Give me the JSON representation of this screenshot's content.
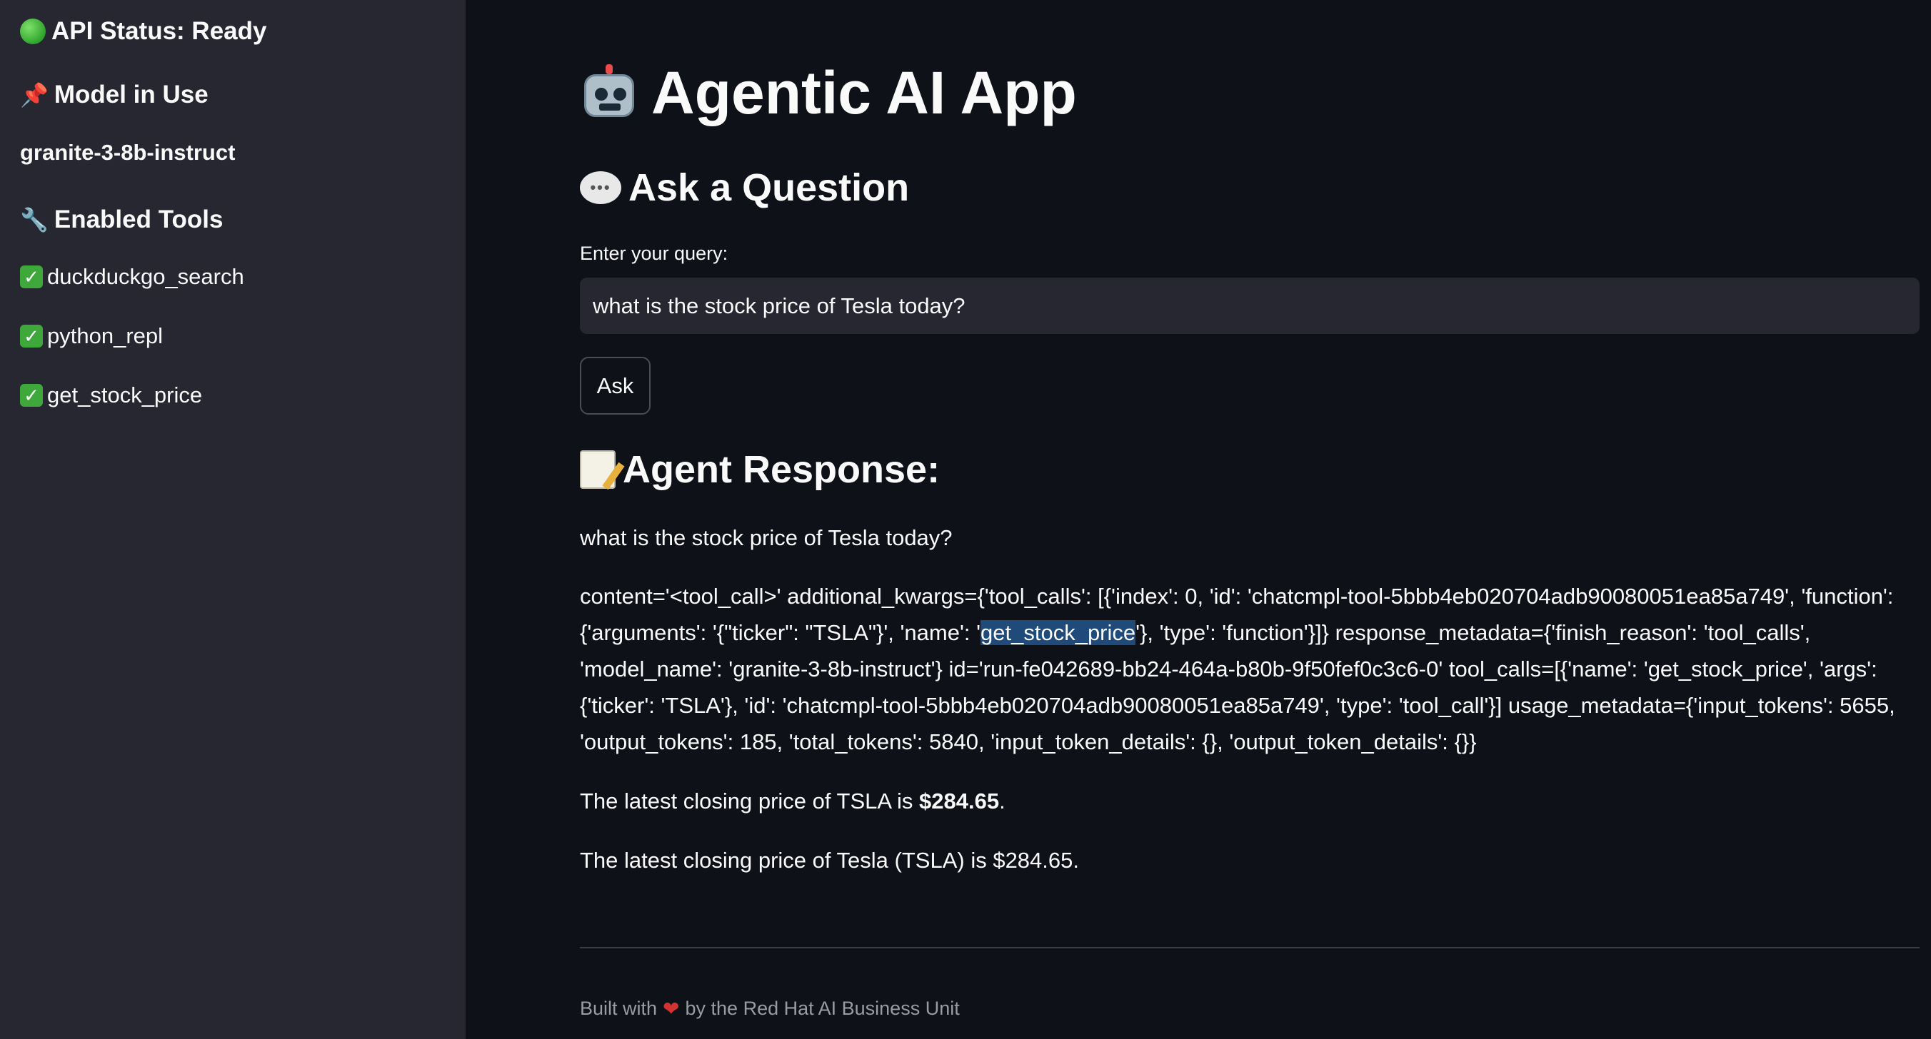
{
  "sidebar": {
    "api_status": "API Status: Ready",
    "model_heading": "Model in Use",
    "model_name": "granite-3-8b-instruct",
    "tools_heading": "Enabled Tools",
    "tools": [
      {
        "label": "duckduckgo_search"
      },
      {
        "label": "python_repl"
      },
      {
        "label": "get_stock_price"
      }
    ],
    "icons": {
      "status": "green-circle-icon",
      "model": "pushpin-icon",
      "tools": "wrench-icon",
      "tool_check": "check-mark-icon"
    }
  },
  "main": {
    "title": "Agentic AI App",
    "ask_heading": "Ask a Question",
    "query_label": "Enter your query:",
    "query_value": "what is the stock price of Tesla today?",
    "ask_button": "Ask",
    "response_heading": "Agent Response:",
    "response_query": "what is the stock price of Tesla today?",
    "raw_part1": "content='<tool_call>' additional_kwargs={'tool_calls': [{'index': 0, 'id': 'chatcmpl-tool-5bbb4eb020704adb90080051ea85a749', 'function': {'arguments': '{\"ticker\": \"TSLA\"}', 'name': '",
    "raw_highlight": "get_stock_price",
    "raw_part2": "'}, 'type': 'function'}]} response_metadata={'finish_reason': 'tool_calls', 'model_name': 'granite-3-8b-instruct'} id='run-fe042689-bb24-464a-b80b-9f50fef0c3c6-0' tool_calls=[{'name': 'get_stock_price', 'args': {'ticker': 'TSLA'}, 'id': 'chatcmpl-tool-5bbb4eb020704adb90080051ea85a749', 'type': 'tool_call'}] usage_metadata={'input_tokens': 5655, 'output_tokens': 185, 'total_tokens': 5840, 'input_token_details': {}, 'output_token_details': {}}",
    "latest_prefix": "The latest closing price of TSLA is ",
    "latest_price": "$284.65",
    "latest_suffix": ".",
    "final_answer": "The latest closing price of Tesla (TSLA) is $284.65.",
    "footer_prefix": "Built with",
    "footer_suffix": "by the Red Hat AI Business Unit"
  },
  "colors": {
    "background": "#0e1117",
    "sidebar": "#262730",
    "input": "#262730",
    "highlight": "#1f4a7a"
  }
}
